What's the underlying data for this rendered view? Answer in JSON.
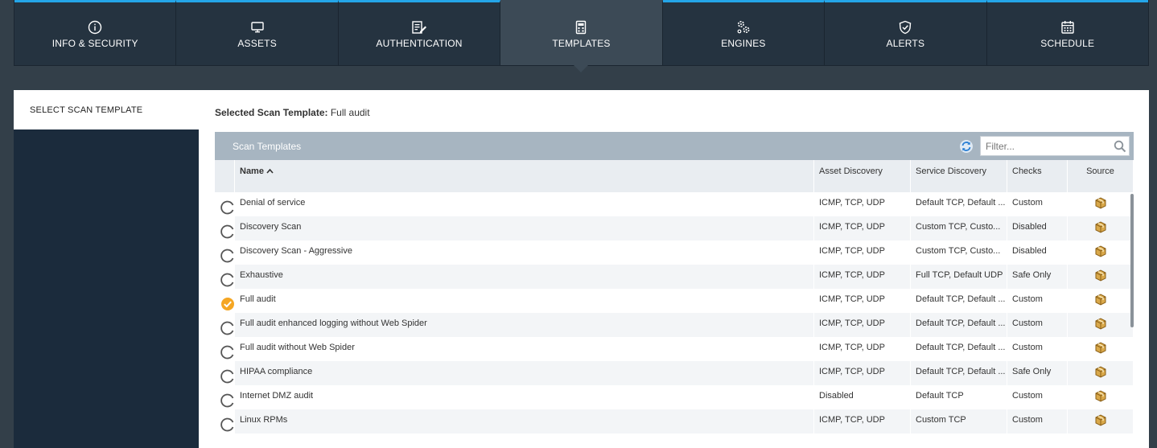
{
  "tabs": [
    {
      "label": "INFO & SECURITY",
      "icon": "info-icon"
    },
    {
      "label": "ASSETS",
      "icon": "monitor-icon"
    },
    {
      "label": "AUTHENTICATION",
      "icon": "edit-doc-icon"
    },
    {
      "label": "TEMPLATES",
      "icon": "calculator-icon",
      "active": true
    },
    {
      "label": "ENGINES",
      "icon": "gears-icon"
    },
    {
      "label": "ALERTS",
      "icon": "shield-check-icon"
    },
    {
      "label": "SCHEDULE",
      "icon": "calendar-icon"
    }
  ],
  "left_panel": {
    "heading": "SELECT SCAN TEMPLATE"
  },
  "selected": {
    "label": "Selected Scan Template:",
    "value": "Full audit"
  },
  "grid": {
    "title": "Scan Templates",
    "filter_placeholder": "Filter...",
    "columns": {
      "name": "Name",
      "asset": "Asset Discovery",
      "service": "Service Discovery",
      "checks": "Checks",
      "source": "Source"
    },
    "rows": [
      {
        "name": "Denial of service",
        "asset": "ICMP, TCP, UDP",
        "service": "Default TCP, Default ...",
        "checks": "Custom",
        "selected": false
      },
      {
        "name": "Discovery Scan",
        "asset": "ICMP, TCP, UDP",
        "service": "Custom TCP, Custo...",
        "checks": "Disabled",
        "selected": false
      },
      {
        "name": "Discovery Scan - Aggressive",
        "asset": "ICMP, TCP, UDP",
        "service": "Custom TCP, Custo...",
        "checks": "Disabled",
        "selected": false
      },
      {
        "name": "Exhaustive",
        "asset": "ICMP, TCP, UDP",
        "service": "Full TCP, Default UDP",
        "checks": "Safe Only",
        "selected": false
      },
      {
        "name": "Full audit",
        "asset": "ICMP, TCP, UDP",
        "service": "Default TCP, Default ...",
        "checks": "Custom",
        "selected": true
      },
      {
        "name": "Full audit enhanced logging without Web Spider",
        "asset": "ICMP, TCP, UDP",
        "service": "Default TCP, Default ...",
        "checks": "Custom",
        "selected": false
      },
      {
        "name": "Full audit without Web Spider",
        "asset": "ICMP, TCP, UDP",
        "service": "Default TCP, Default ...",
        "checks": "Custom",
        "selected": false
      },
      {
        "name": "HIPAA compliance",
        "asset": "ICMP, TCP, UDP",
        "service": "Default TCP, Default ...",
        "checks": "Safe Only",
        "selected": false
      },
      {
        "name": "Internet DMZ audit",
        "asset": "Disabled",
        "service": "Default TCP",
        "checks": "Custom",
        "selected": false
      },
      {
        "name": "Linux RPMs",
        "asset": "ICMP, TCP, UDP",
        "service": "Custom TCP",
        "checks": "Custom",
        "selected": false
      }
    ]
  },
  "colors": {
    "accent": "#24a5e8",
    "selected": "#f5a623",
    "nav_bg": "#253340"
  }
}
